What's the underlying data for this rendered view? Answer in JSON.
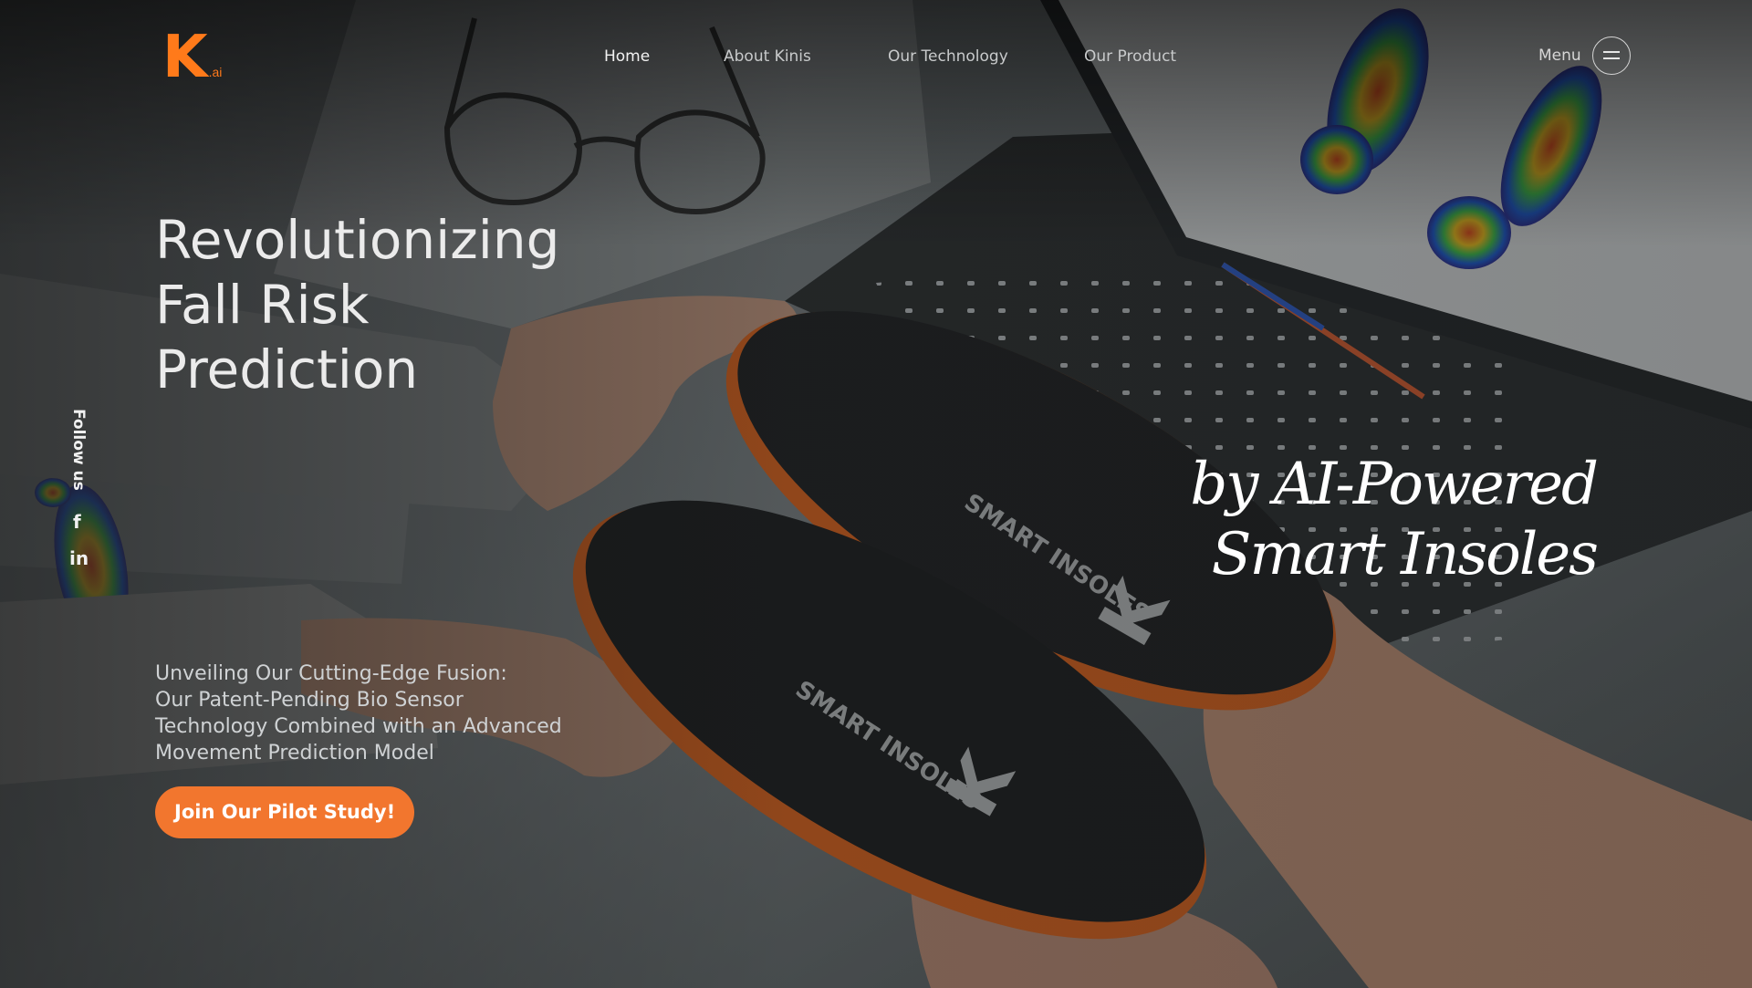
{
  "brand": {
    "mark": "K",
    "suffix": ".ai",
    "color": "#ff7a1a"
  },
  "nav": {
    "items": [
      {
        "label": "Home",
        "active": true
      },
      {
        "label": "About Kinis",
        "active": false
      },
      {
        "label": "Our Technology",
        "active": false
      },
      {
        "label": "Our Product",
        "active": false
      }
    ],
    "menu_label": "Menu"
  },
  "social": {
    "label": "Follow us",
    "links": [
      {
        "icon": "facebook-icon",
        "glyph": "f"
      },
      {
        "icon": "linkedin-icon",
        "glyph": "in"
      }
    ]
  },
  "hero": {
    "title_lines": [
      "Revolutionizing",
      "Fall Risk",
      "Prediction"
    ],
    "tagline_lines": [
      "by AI-Powered",
      "Smart Insoles"
    ],
    "subtitle_lines": [
      "Unveiling Our Cutting-Edge Fusion:",
      "Our Patent-Pending Bio Sensor",
      "Technology Combined with an Advanced",
      "Movement Prediction Model"
    ],
    "cta_label": "Join Our Pilot Study!",
    "cta_color": "#f2762e"
  },
  "background": {
    "insole_print": "SMART INSOLES",
    "insole_logo": "K"
  }
}
